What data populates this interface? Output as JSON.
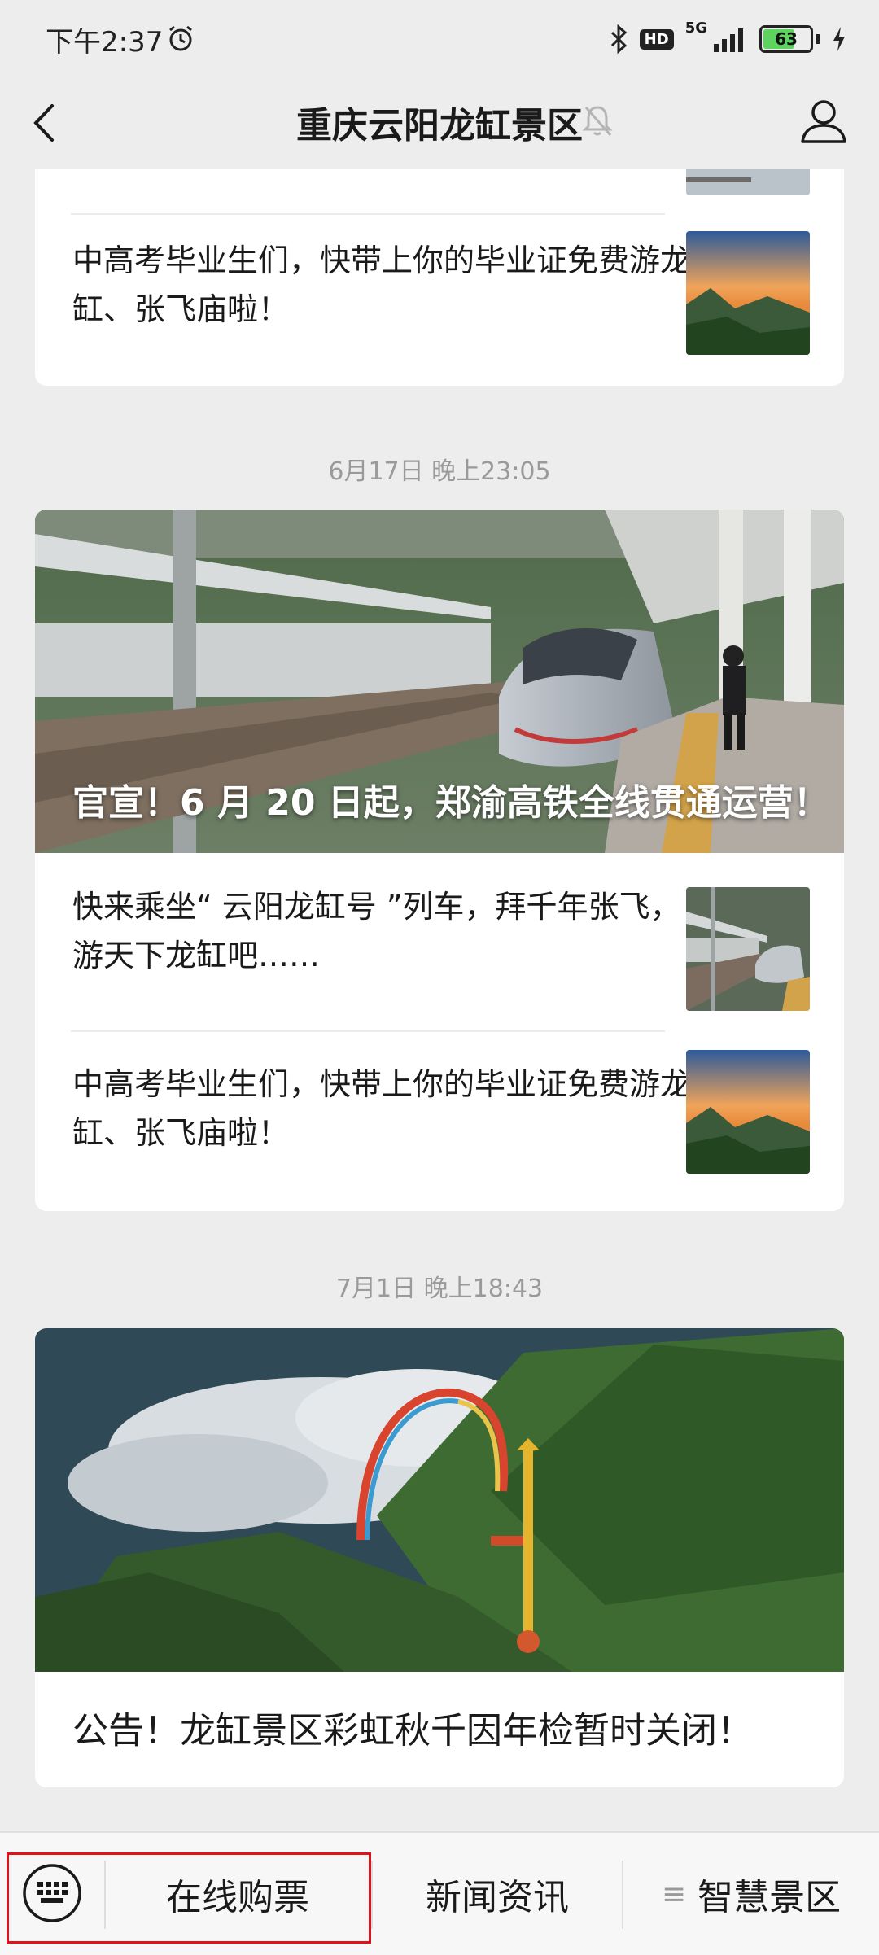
{
  "status_bar": {
    "time": "下午2:37",
    "hd": "HD",
    "network": "5G",
    "battery": "63"
  },
  "nav": {
    "title": "重庆云阳龙缸景区",
    "back_icon": "chevron-left-icon",
    "muted_icon": "bell-muted-icon",
    "profile_icon": "person-icon"
  },
  "feed": {
    "card1": {
      "row2_title": "中高考毕业生们，快带上你的毕业证免费游龙缸、张飞庙啦！"
    },
    "group2": {
      "timestamp": "6月17日 晚上23:05",
      "hero_title": "官宣！6 月 20 日起，郑渝高铁全线贯通运营！",
      "rows": [
        {
          "title": "快来乘坐“ 云阳龙缸号 ”列车，拜千年张飞，游天下龙缸吧……"
        },
        {
          "title": "中高考毕业生们，快带上你的毕业证免费游龙缸、张飞庙啦！"
        }
      ]
    },
    "group3": {
      "timestamp": "7月1日 晚上18:43",
      "title": "公告！龙缸景区彩虹秋千因年检暂时关闭！"
    }
  },
  "bottom_menu": {
    "keyboard_icon": "keyboard-icon",
    "items": [
      {
        "label": "在线购票"
      },
      {
        "label": "新闻资讯"
      },
      {
        "label": "智慧景区"
      }
    ],
    "highlight_color": "#e0121b"
  }
}
